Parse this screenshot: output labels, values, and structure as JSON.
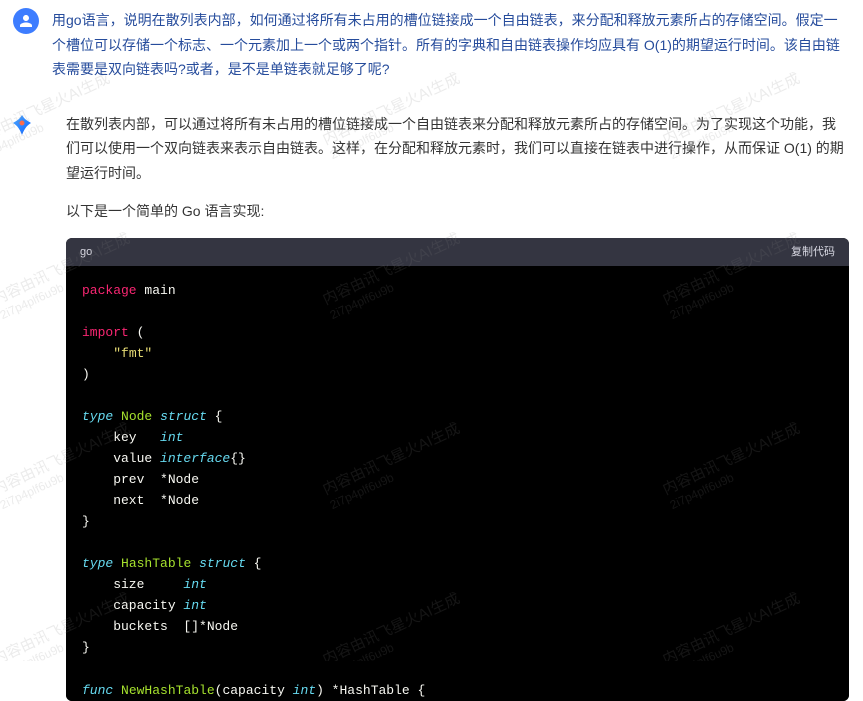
{
  "user": {
    "message": "用go语言，说明在散列表内部，如何通过将所有未占用的槽位链接成一个自由链表，来分配和释放元素所占的存储空间。假定一个槽位可以存储一个标志、一个元素加上一个或两个指针。所有的字典和自由链表操作均应具有 O(1)的期望运行时间。该自由链表需要是双向链表吗?或者，是不是单链表就足够了呢?"
  },
  "assistant": {
    "p1": "在散列表内部，可以通过将所有未占用的槽位链接成一个自由链表来分配和释放元素所占的存储空间。为了实现这个功能，我们可以使用一个双向链表来表示自由链表。这样，在分配和释放元素时，我们可以直接在链表中进行操作，从而保证 O(1) 的期望运行时间。",
    "p2": "以下是一个简单的 Go 语言实现:"
  },
  "code_block": {
    "language": "go",
    "copy_label": "复制代码",
    "lines": {
      "l1_package": "package",
      "l1_main": "main",
      "l_blank": "",
      "l3_import": "import",
      "l3_paren": " (",
      "l4_str": "\"fmt\"",
      "l5_close": ")",
      "l_type": "type",
      "l_node": "Node",
      "l_struct": "struct",
      "l_open": " {",
      "l_key": "    key   ",
      "l_int": "int",
      "l_value": "    value ",
      "l_interface": "interface",
      "l_braces_empty": "{}",
      "l_prev": "    prev  *",
      "l_nodename": "Node",
      "l_next": "    next  *",
      "l_close_brace": "}",
      "l_hashtable": "HashTable",
      "l_size": "    size     ",
      "l_capacity": "    capacity ",
      "l_buckets": "    buckets  []*",
      "l_func": "func",
      "l_newhash": "NewHashTable",
      "l_params_open": "(capacity ",
      "l_params_close": ") *",
      "l_hashname": "HashTable"
    }
  },
  "watermark": {
    "line1": "内容由讯飞星火AI生成",
    "line2": "2i7p4plf6u9b"
  }
}
